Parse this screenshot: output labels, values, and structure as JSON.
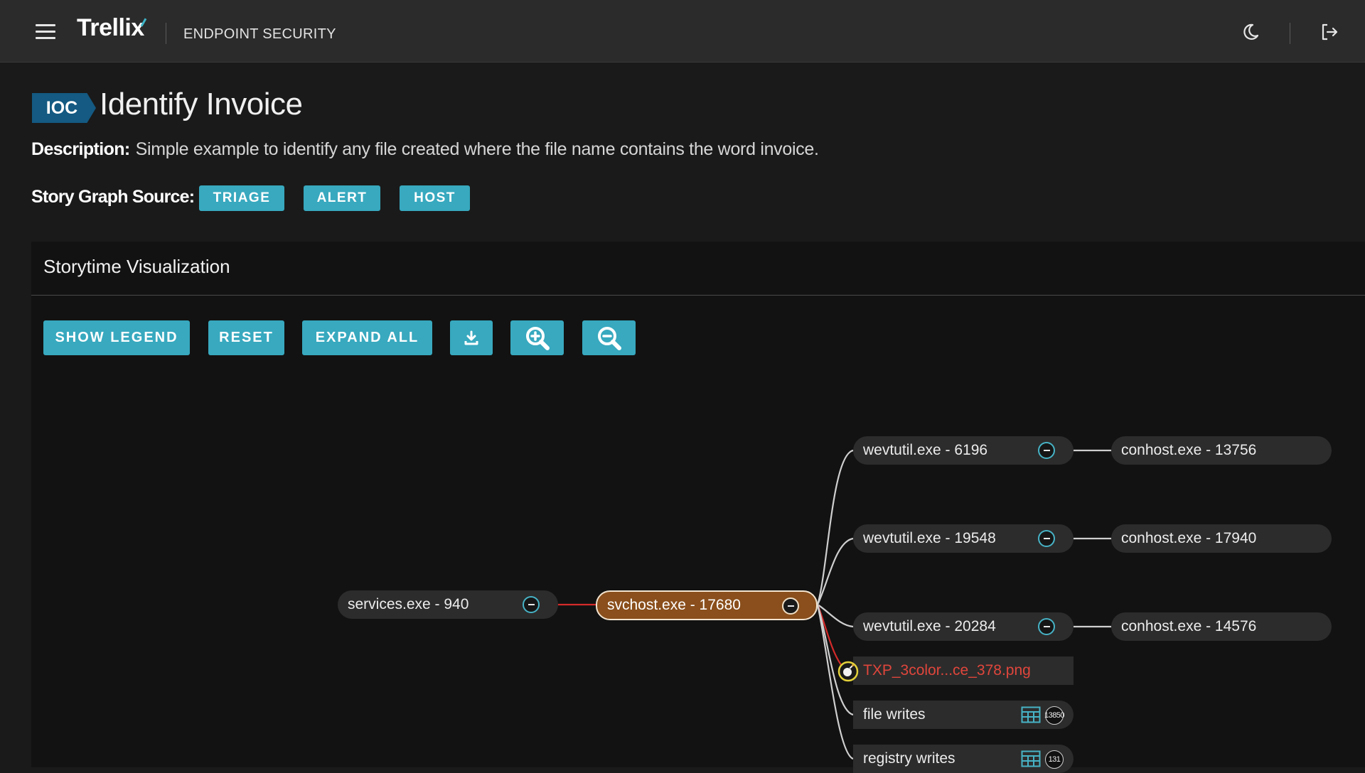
{
  "topbar": {
    "brand": "Trellix",
    "product": "ENDPOINT SECURITY",
    "icons": [
      "menu-icon",
      "moon-icon",
      "logout-icon"
    ]
  },
  "header": {
    "badge": "IOC",
    "title": "Identify Invoice",
    "description_label": "Description:",
    "description": "Simple example to identify any file created where the file name contains the word invoice.",
    "source_label": "Story Graph Source:",
    "sources": [
      "TRIAGE",
      "ALERT",
      "HOST"
    ]
  },
  "panel": {
    "title": "Storytime Visualization",
    "toolbar": {
      "show_legend": "SHOW LEGEND",
      "reset": "RESET",
      "expand_all": "EXPAND ALL",
      "icons": [
        "download-icon",
        "zoom-in-icon",
        "zoom-out-icon"
      ]
    }
  },
  "graph": {
    "nodes": {
      "services": "services.exe - 940",
      "svchost": "svchost.exe - 17680",
      "wevtutil_1": "wevtutil.exe - 6196",
      "wevtutil_2": "wevtutil.exe - 19548",
      "wevtutil_3": "wevtutil.exe - 20284",
      "conhost_1": "conhost.exe - 13756",
      "conhost_2": "conhost.exe - 17940",
      "conhost_3": "conhost.exe - 14576",
      "file_alert": "TXP_3color...ce_378.png",
      "file_writes": "file writes",
      "registry_writes": "registry writes"
    },
    "counts": {
      "file_writes": "13850",
      "registry_writes": "131"
    },
    "colors": {
      "accent": "#38a9bf",
      "active_node": "#8a4f1c",
      "alert_edge": "#d42a2a",
      "alert_text": "#e0463c"
    }
  }
}
